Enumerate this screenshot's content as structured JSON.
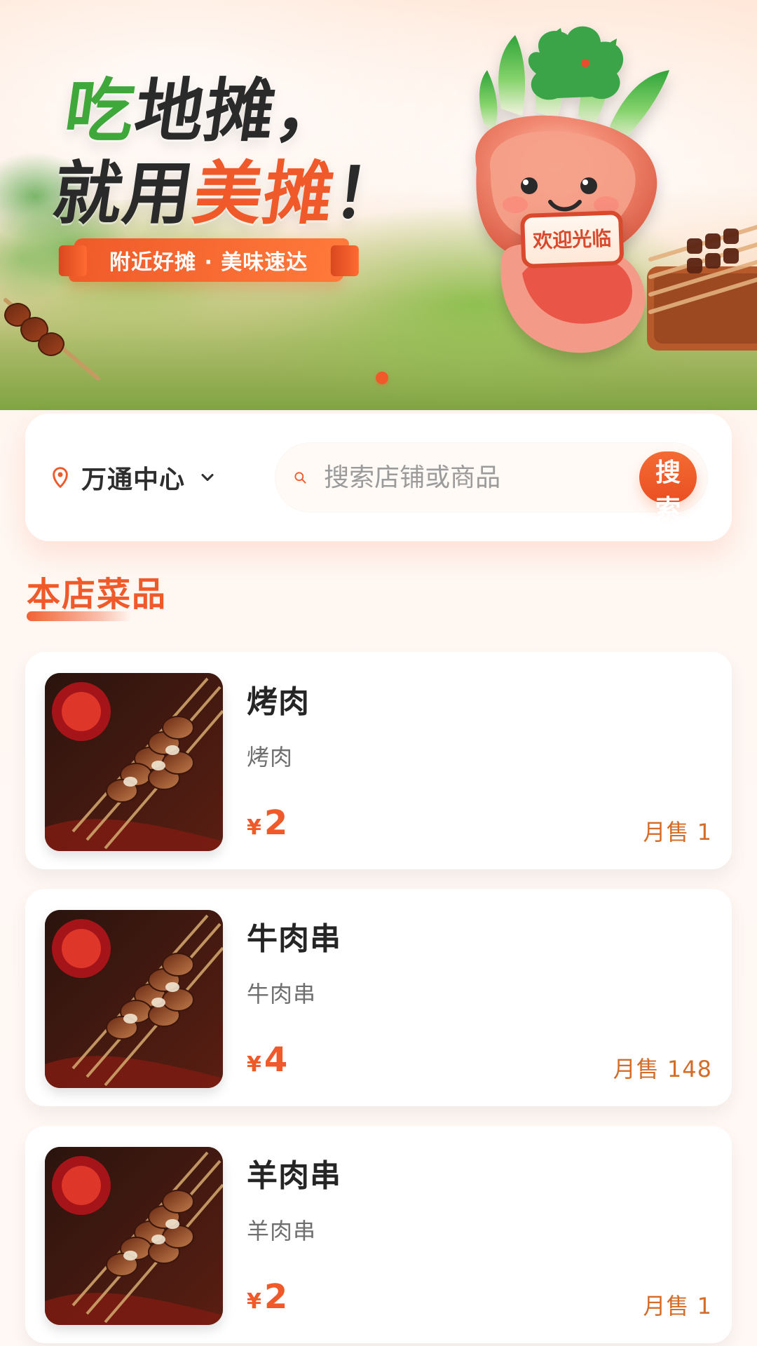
{
  "banner": {
    "headline": {
      "line1_green": "吃",
      "line1_rest": "地摊，",
      "line2_prefix": "就用",
      "line2_orange": "美摊",
      "line2_suffix": "！"
    },
    "ribbon": "附近好摊 · 美味速达",
    "mascot_sign": "欢迎光临",
    "pager_active_index": 0
  },
  "search": {
    "location": "万通中心",
    "placeholder": "搜索店铺或商品",
    "button": "搜索"
  },
  "section": {
    "title": "本店菜品"
  },
  "items": [
    {
      "name": "烤肉",
      "desc": "烤肉",
      "price_symbol": "¥",
      "price": "2",
      "sales": "月售 1"
    },
    {
      "name": "牛肉串",
      "desc": "牛肉串",
      "price_symbol": "¥",
      "price": "4",
      "sales": "月售 148"
    },
    {
      "name": "羊肉串",
      "desc": "羊肉串",
      "price_symbol": "¥",
      "price": "2",
      "sales": "月售 1"
    }
  ],
  "theme": {
    "accent": "#f05a2a",
    "sales": "#d46c2a",
    "green": "#3ea83a"
  },
  "icons": {
    "location": "location-pin-icon",
    "chevron": "chevron-down-icon",
    "search": "search-icon"
  }
}
